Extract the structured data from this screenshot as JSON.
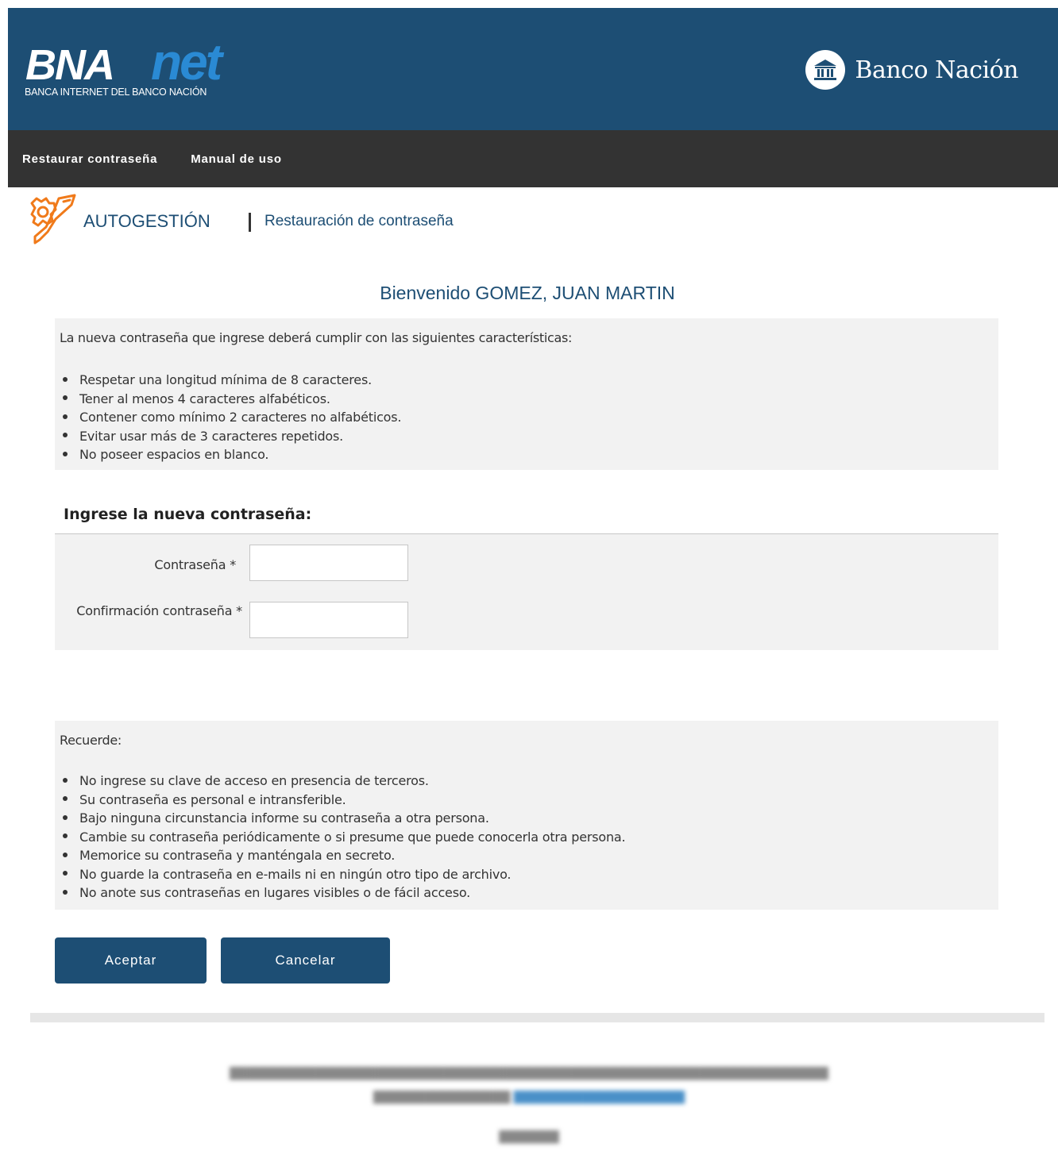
{
  "header": {
    "logo_text": "BNAnet",
    "logo_tagline": "BANCA INTERNET DEL BANCO NACIÓN",
    "bank_name": "Banco Nación",
    "colors": {
      "brand": "#1d4e74",
      "accent": "#2a8ad4",
      "nav": "#333333"
    }
  },
  "nav": {
    "items": [
      {
        "label": "Restaurar contraseña"
      },
      {
        "label": "Manual de uso"
      }
    ]
  },
  "breadcrumb": {
    "icon": "gear-wrench-icon",
    "title": "AUTOGESTIÓN",
    "subtitle": "Restauración de contraseña"
  },
  "welcome": "Bienvenido GOMEZ, JUAN MARTIN",
  "requirements": {
    "intro": "La nueva contraseña que ingrese deberá cumplir con las siguientes características:",
    "items": [
      "Respetar una longitud mínima de 8 caracteres.",
      "Tener al menos 4 caracteres alfabéticos.",
      "Contener como mínimo 2 caracteres no alfabéticos.",
      "Evitar usar más de 3 caracteres repetidos.",
      "No poseer espacios en blanco."
    ]
  },
  "form": {
    "title": "Ingrese la nueva contraseña:",
    "password_label": "Contraseña *",
    "password_value": "",
    "confirm_label": "Confirmación contraseña *",
    "confirm_value": ""
  },
  "reminder": {
    "intro": "Recuerde:",
    "items": [
      "No ingrese su clave de acceso en presencia de terceros.",
      "Su contraseña es personal e intransferible.",
      "Bajo ninguna circunstancia informe su contraseña a otra persona.",
      "Cambie su contraseña periódicamente o si presume que puede conocerla otra persona.",
      "Memorice su contraseña y manténgala en secreto.",
      "No guarde la contraseña en e-mails ni en ningún otro tipo de archivo.",
      "No anote sus contraseñas en lugares visibles o de fácil acceso."
    ]
  },
  "buttons": {
    "accept": "Aceptar",
    "cancel": "Cancelar"
  }
}
